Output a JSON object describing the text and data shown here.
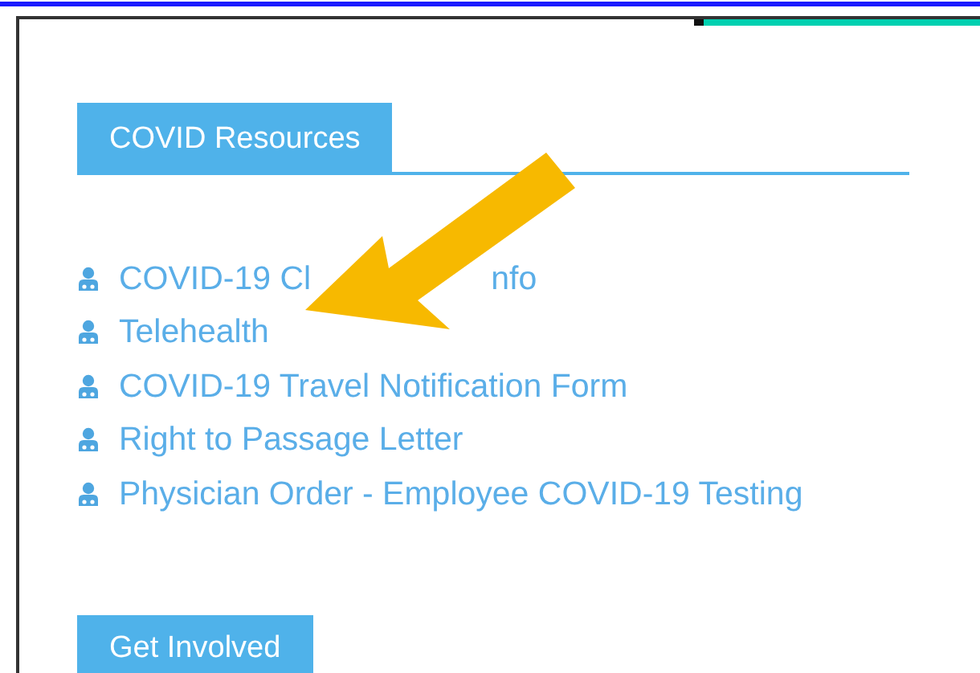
{
  "section": {
    "title": "COVID Resources"
  },
  "links": [
    {
      "text": "COVID-19 Cl",
      "text_after": "nfo"
    },
    {
      "text": "Telehealth"
    },
    {
      "text": "COVID-19 Travel Notification Form"
    },
    {
      "text": "Right to Passage Letter"
    },
    {
      "text": "Physician Order - Employee COVID-19 Testing"
    }
  ],
  "button": {
    "label": "Get Involved"
  }
}
